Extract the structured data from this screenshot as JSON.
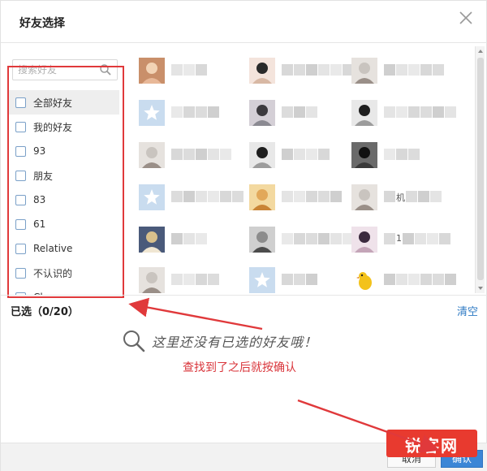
{
  "dialog": {
    "title": "好友选择",
    "close_icon": "close-icon"
  },
  "groups": {
    "search_placeholder": "搜索好友",
    "items": [
      {
        "label": "全部好友",
        "checked": false,
        "selected": true
      },
      {
        "label": "我的好友",
        "checked": false,
        "selected": false
      },
      {
        "label": "93",
        "checked": false,
        "selected": false
      },
      {
        "label": "朋友",
        "checked": false,
        "selected": false
      },
      {
        "label": "83",
        "checked": false,
        "selected": false
      },
      {
        "label": "61",
        "checked": false,
        "selected": false
      },
      {
        "label": "Relative",
        "checked": false,
        "selected": false
      },
      {
        "label": "不认识的",
        "checked": false,
        "selected": false
      },
      {
        "label": "Cl",
        "checked": false,
        "selected": false
      }
    ]
  },
  "friends": [
    {
      "avatar": "baby-photo",
      "name_blurred": true
    },
    {
      "avatar": "two-girls-photo",
      "name_blurred": true
    },
    {
      "avatar": "person-photo",
      "name_blurred": true
    },
    {
      "avatar": "default-star-avatar",
      "name_blurred": true
    },
    {
      "avatar": "girl-closeup-photo",
      "name_blurred": true
    },
    {
      "avatar": "man-sunglasses-photo",
      "name_blurred": true
    },
    {
      "avatar": "person-photo",
      "name_blurred": true
    },
    {
      "avatar": "man-sunglasses-photo",
      "name_blurred": true
    },
    {
      "avatar": "dark-photo",
      "name_blurred": true
    },
    {
      "avatar": "default-star-avatar",
      "name_blurred": true
    },
    {
      "avatar": "food-photo",
      "name_blurred": true
    },
    {
      "avatar": "person-photo",
      "name_blurred": true,
      "name_fragment": "机"
    },
    {
      "avatar": "blond-man-photo",
      "name_blurred": true
    },
    {
      "avatar": "car-photo",
      "name_blurred": true
    },
    {
      "avatar": "woman-photo",
      "name_blurred": true,
      "name_fragment": "1"
    },
    {
      "avatar": "person-photo",
      "name_blurred": true
    },
    {
      "avatar": "default-star-avatar",
      "name_blurred": true
    },
    {
      "avatar": "yellow-chick-avatar",
      "name_blurred": true
    }
  ],
  "selection": {
    "count_label": "已选（0/20）",
    "clear_label": "清空",
    "empty_message": "这里还没有已选的好友哦！"
  },
  "annotation": {
    "text": "查找到了之后就按确认"
  },
  "footer": {
    "cancel_label": "取消",
    "confirm_label": "确认"
  },
  "watermark": {
    "text": "锐客网"
  },
  "colors": {
    "accent": "#3b86d6",
    "link": "#2f7bc4",
    "annotation_red": "#e0393b",
    "watermark_red": "#e83a2f"
  }
}
